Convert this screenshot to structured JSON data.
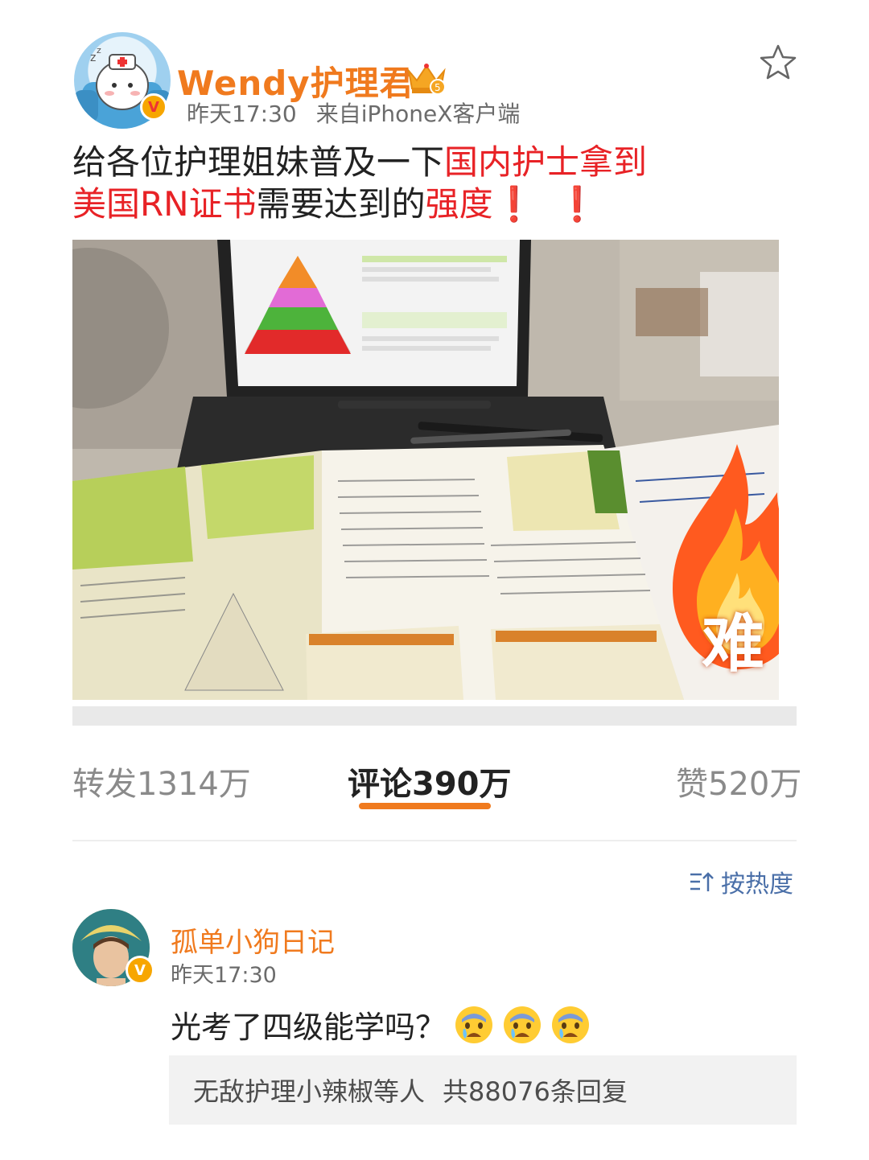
{
  "post": {
    "author": "Wendy护理君",
    "time": "昨天17:30",
    "source": "来自iPhoneX客户端",
    "text_parts": {
      "p1": "给各位护理姐妹普及一下",
      "p2": "国内护士拿到",
      "p3": "美国RN证书",
      "p4": "需要达到的",
      "p5": "强度",
      "bang1": "❗",
      "bang2": "❗"
    },
    "image_badge": "难",
    "vip_level": "5"
  },
  "counts": {
    "repost": "转发1314万",
    "comment": "评论390万",
    "like": "赞520万"
  },
  "sort": {
    "label": "按热度"
  },
  "comment": {
    "author": "孤单小狗日记",
    "time": "昨天17:30",
    "text": "光考了四级能学吗？",
    "reply_summary_user": "无敌护理小辣椒等人",
    "reply_summary_count": "共88076条回复"
  },
  "colors": {
    "accent": "#f07a1e",
    "highlight": "#e82226",
    "link": "#4a6fa8"
  },
  "icons": [
    "star-icon",
    "crown-icon",
    "verified-icon",
    "sort-icon",
    "fire-icon",
    "cry-emoji-icon"
  ]
}
